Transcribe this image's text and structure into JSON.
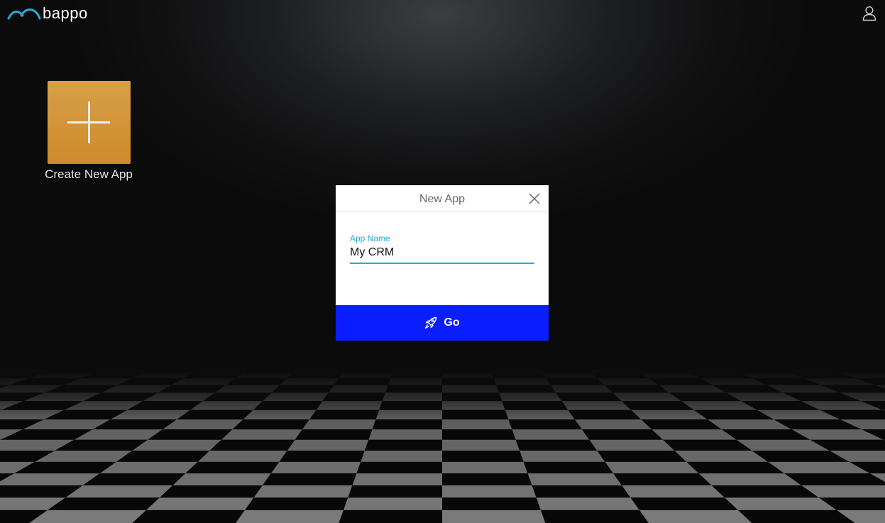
{
  "brand": {
    "name": "bappo",
    "logo_icon": "bappo-arc-logo-icon",
    "accent_color": "#29a9d6"
  },
  "header": {
    "user_icon": "user-icon"
  },
  "create_tile": {
    "label": "Create New App",
    "icon": "plus-icon",
    "color": "#d0912f"
  },
  "modal": {
    "title": "New App",
    "close_icon": "close-icon",
    "field_label": "App Name",
    "field_value": "My CRM",
    "go_label": "Go",
    "go_icon": "rocket-icon",
    "go_color": "#0a1eff"
  }
}
